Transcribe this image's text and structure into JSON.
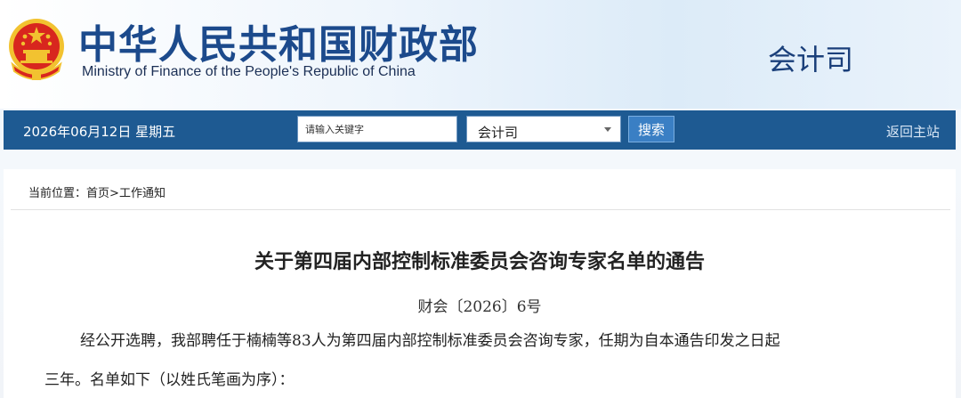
{
  "header": {
    "title_cn": "中华人民共和国财政部",
    "title_en": "Ministry of Finance of the People's Republic of China",
    "department": "会计司",
    "emblem_icon": "national-emblem-icon"
  },
  "navbar": {
    "date": "2026年06月12日  星期五",
    "search": {
      "placeholder": "请输入关键字",
      "value": ""
    },
    "scope_select": {
      "selected": "会计司"
    },
    "search_button": "搜索",
    "back_home": "返回主站"
  },
  "breadcrumb": {
    "prefix": "当前位置：",
    "home": "首页",
    "separator": ">",
    "current": "工作通知"
  },
  "article": {
    "title": "关于第四届内部控制标准委员会咨询专家名单的通告",
    "doc_number": "财会〔2026〕6号",
    "paragraph_1": "经公开选聘，我部聘任于楠楠等83人为第四届内部控制标准委员会咨询专家，任期为自本通告印发之日起",
    "paragraph_2": "三年。名单如下（以姓氏笔画为序）："
  },
  "colors": {
    "nav_bg": "#1e5a92",
    "title_blue": "#1c4a8c",
    "emblem_red": "#d8261e",
    "emblem_gold": "#f2c230"
  }
}
